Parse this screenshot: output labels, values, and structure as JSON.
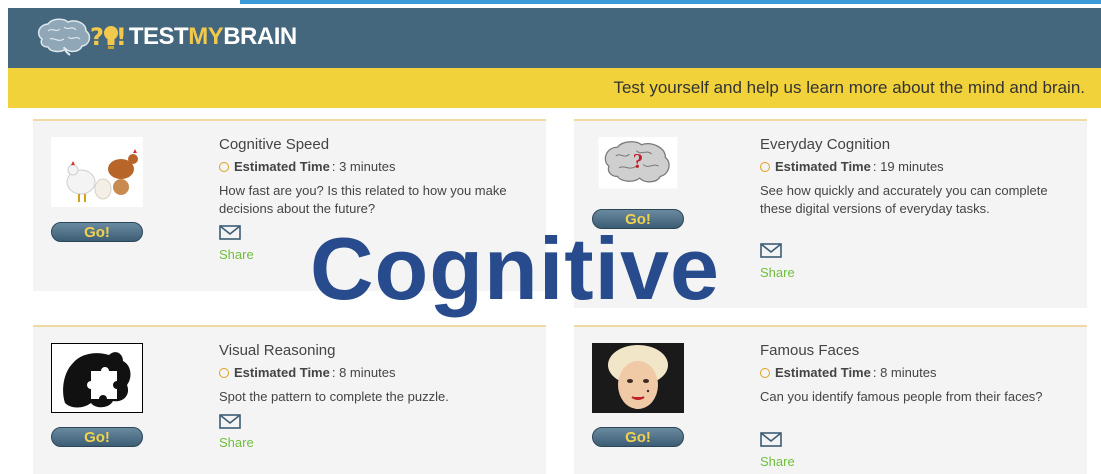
{
  "header": {
    "logo_q": "?",
    "logo_bang": "!",
    "logo_test": "TEST",
    "logo_my": "MY",
    "logo_brain": "BRAIN"
  },
  "banner": {
    "tagline": "Test yourself and help us learn more about the mind and brain."
  },
  "overlay": {
    "text": "Cognitive"
  },
  "cards": [
    {
      "title": "Cognitive Speed",
      "est_label": "Estimated Time",
      "est_value": ": 3 minutes",
      "description": "How fast are you? Is this related to how you make decisions about the future?",
      "go_label": "Go!",
      "share_label": "Share"
    },
    {
      "title": "Everyday Cognition",
      "est_label": "Estimated Time",
      "est_value": ": 19 minutes",
      "description": "See how quickly and accurately you can complete these digital versions of everyday tasks.",
      "go_label": "Go!",
      "share_label": "Share"
    },
    {
      "title": "Visual Reasoning",
      "est_label": "Estimated Time",
      "est_value": ": 8 minutes",
      "description": "Spot the pattern to complete the puzzle.",
      "go_label": "Go!",
      "share_label": "Share"
    },
    {
      "title": "Famous Faces",
      "est_label": "Estimated Time",
      "est_value": ": 8 minutes",
      "description": "Can you identify famous people from their faces?",
      "go_label": "Go!",
      "share_label": "Share"
    }
  ],
  "icons": {
    "logo": "brain-icon",
    "clock": "clock-icon",
    "mail": "envelope-icon",
    "thumbs": [
      "chickens-eggs-image",
      "brain-question-image",
      "puzzle-head-image",
      "portrait-image"
    ]
  },
  "colors": {
    "header": "#44677e",
    "banner": "#f1d23a",
    "go_button": "#3c5d74",
    "go_text": "#f2d24c",
    "share": "#6fbf3d",
    "overlay": "#274b8c"
  }
}
